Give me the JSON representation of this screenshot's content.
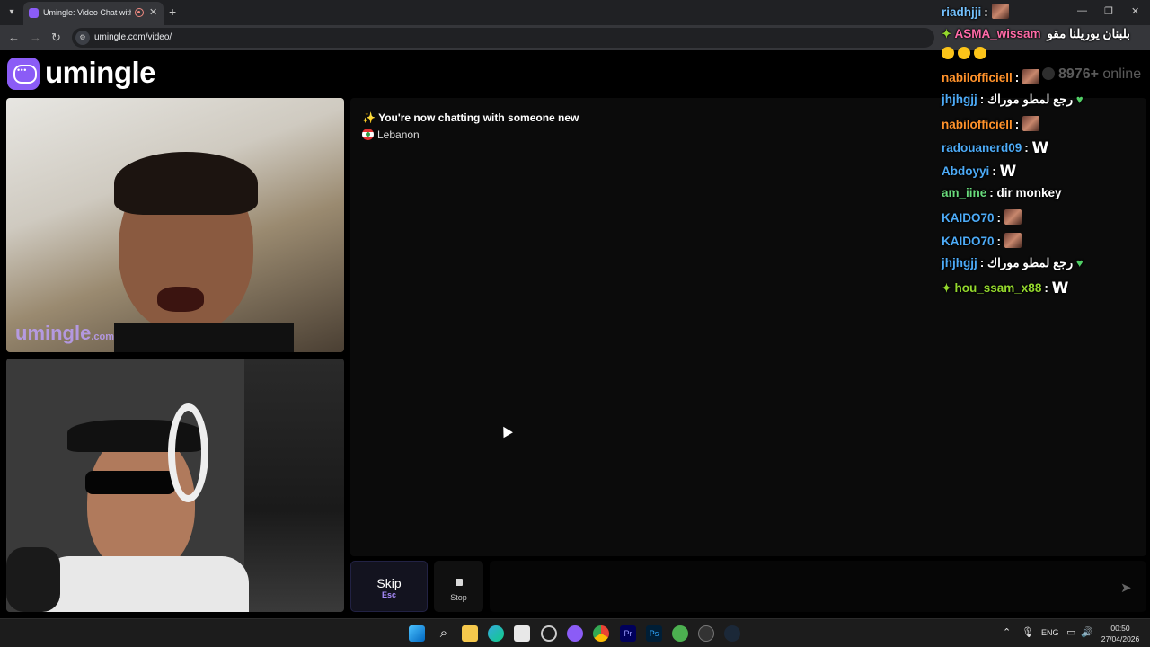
{
  "browser": {
    "tab_title": "Umingle: Video Chat with S",
    "url": "umingle.com/video/",
    "new_tab_label": "+",
    "tab_close_label": "✕"
  },
  "site": {
    "logo_text": "umingle",
    "online_count": "8976+",
    "online_label": "online"
  },
  "remote_video": {
    "watermark_main": "umingle",
    "watermark_suffix": ".com"
  },
  "chat": {
    "status_icon": "✨",
    "status_message": "You're now chatting with someone new",
    "country": "Lebanon",
    "skip_label": "Skip",
    "skip_key": "Esc",
    "stop_label": "Stop"
  },
  "stream_chat": [
    {
      "name": "riadhjji",
      "color": "#74c0fc",
      "sep": " : ",
      "content": "",
      "emote": "face"
    },
    {
      "name": "ASMA_wissam",
      "color": "#ff6ba8",
      "sep": " ",
      "content": "بلبنان يوريلنا مقو",
      "badge": "star"
    },
    {
      "name": "",
      "color": "#fff",
      "sep": "",
      "content": "",
      "emote": "laugh3"
    },
    {
      "name": "nabilofficiell",
      "color": "#ff922b",
      "sep": " : ",
      "content": "",
      "emote": "face"
    },
    {
      "name": "jhjhgjj",
      "color": "#4dabf7",
      "sep": " : ",
      "content": "رجع لمطو موراك",
      "emote": "heart"
    },
    {
      "name": "nabilofficiell",
      "color": "#ff922b",
      "sep": " : ",
      "content": "",
      "emote": "face"
    },
    {
      "name": "radouanerd09",
      "color": "#4dabf7",
      "sep": " : ",
      "content": "",
      "emote": "W"
    },
    {
      "name": "Abdoyyi",
      "color": "#4dabf7",
      "sep": " : ",
      "content": "",
      "emote": "W"
    },
    {
      "name": "am_iine",
      "color": "#69db7c",
      "sep": " : ",
      "content": "dir monkey",
      "emote": ""
    },
    {
      "name": "KAIDO70",
      "color": "#4dabf7",
      "sep": " : ",
      "content": "",
      "emote": "face"
    },
    {
      "name": "KAIDO70",
      "color": "#4dabf7",
      "sep": " : ",
      "content": "",
      "emote": "face"
    },
    {
      "name": "jhjhgjj",
      "color": "#4dabf7",
      "sep": " : ",
      "content": "رجع لمطو موراك",
      "emote": "heart"
    },
    {
      "name": "hou_ssam_x88",
      "color": "#94d82d",
      "sep": " : ",
      "content": "",
      "emote": "W",
      "badge": "star"
    }
  ],
  "taskbar": {
    "lang": "ENG",
    "time": "00:50",
    "date": "27/04/2026"
  },
  "colors": {
    "brand": "#8b5cf6",
    "skip_key": "#a78bfa"
  }
}
